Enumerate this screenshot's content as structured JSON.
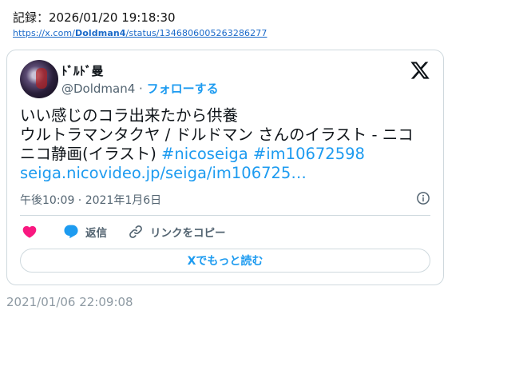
{
  "record": {
    "label": "記録：2026/01/20 19:18:30",
    "url_prefix": "https://x.com/",
    "url_user": "Doldman4",
    "url_suffix": "/status/1346806005263286277"
  },
  "tweet": {
    "display_name": "ﾄﾞﾙﾄﾞ曼",
    "handle": "@Doldman4",
    "separator": " · ",
    "follow_label": "フォローする",
    "text_line1": "いい感じのコラ出来たから供養",
    "text_line2": "ウルトラマンタクヤ / ドルドマン さんのイラスト - ニコニコ静画(イラスト) ",
    "hashtag1": "#nicoseiga",
    "hashtag2": "#im10672598",
    "link_text": "seiga.nicovideo.jp/seiga/im106725…",
    "timestamp": "午後10:09 · 2021年1月6日",
    "reply_label": "返信",
    "copy_link_label": "リンクをコピー",
    "read_more_label": "Xでもっと読む",
    "icons": {
      "x_logo": "x-logo-icon",
      "info": "info-icon",
      "like": "heart-icon",
      "reply": "speech-bubble-icon",
      "link": "link-icon"
    },
    "colors": {
      "accent": "#1d9bf0",
      "like": "#f91880",
      "muted": "#536471",
      "border": "#cfd9de"
    }
  },
  "footer": {
    "date": "2021/01/06 22:09:08"
  }
}
